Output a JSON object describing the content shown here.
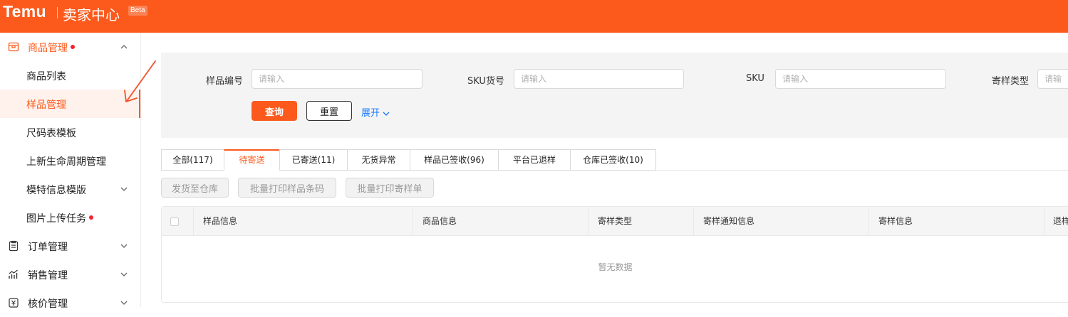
{
  "header": {
    "brand": "Temu",
    "center_title": "卖家中心",
    "beta": "Beta",
    "bg_color": "#fb5a1c"
  },
  "sidebar": {
    "product_mgmt": "商品管理",
    "sub_items": [
      "商品列表",
      "样品管理",
      "尺码表模板",
      "上新生命周期管理",
      "模特信息模版",
      "图片上传任务"
    ],
    "order_mgmt": "订单管理",
    "sales_mgmt": "销售管理",
    "price_mgmt": "核价管理",
    "active_item": "样品管理"
  },
  "filter": {
    "fields": [
      {
        "label": "样品编号",
        "placeholder": "请输入"
      },
      {
        "label": "SKU货号",
        "placeholder": "请输入"
      },
      {
        "label": "SKU",
        "placeholder": "请输入"
      },
      {
        "label": "寄样类型",
        "placeholder": "请输入"
      }
    ],
    "query_button": "查询",
    "reset_button": "重置",
    "expand_link": "展开"
  },
  "tabs": [
    "全部(117)",
    "待寄送",
    "已寄送(11)",
    "无货异常",
    "样品已签收(96)",
    "平台已退样",
    "仓库已签收(10)"
  ],
  "active_tab": "待寄送",
  "actions": [
    "发货至仓库",
    "批量打印样品条码",
    "批量打印寄样单"
  ],
  "table": {
    "columns": [
      "样品信息",
      "商品信息",
      "寄样类型",
      "寄样通知信息",
      "寄样信息",
      "退样"
    ],
    "empty_text": "暂无数据"
  },
  "accent_color": "#fb5a1c",
  "link_color": "#1677ff"
}
